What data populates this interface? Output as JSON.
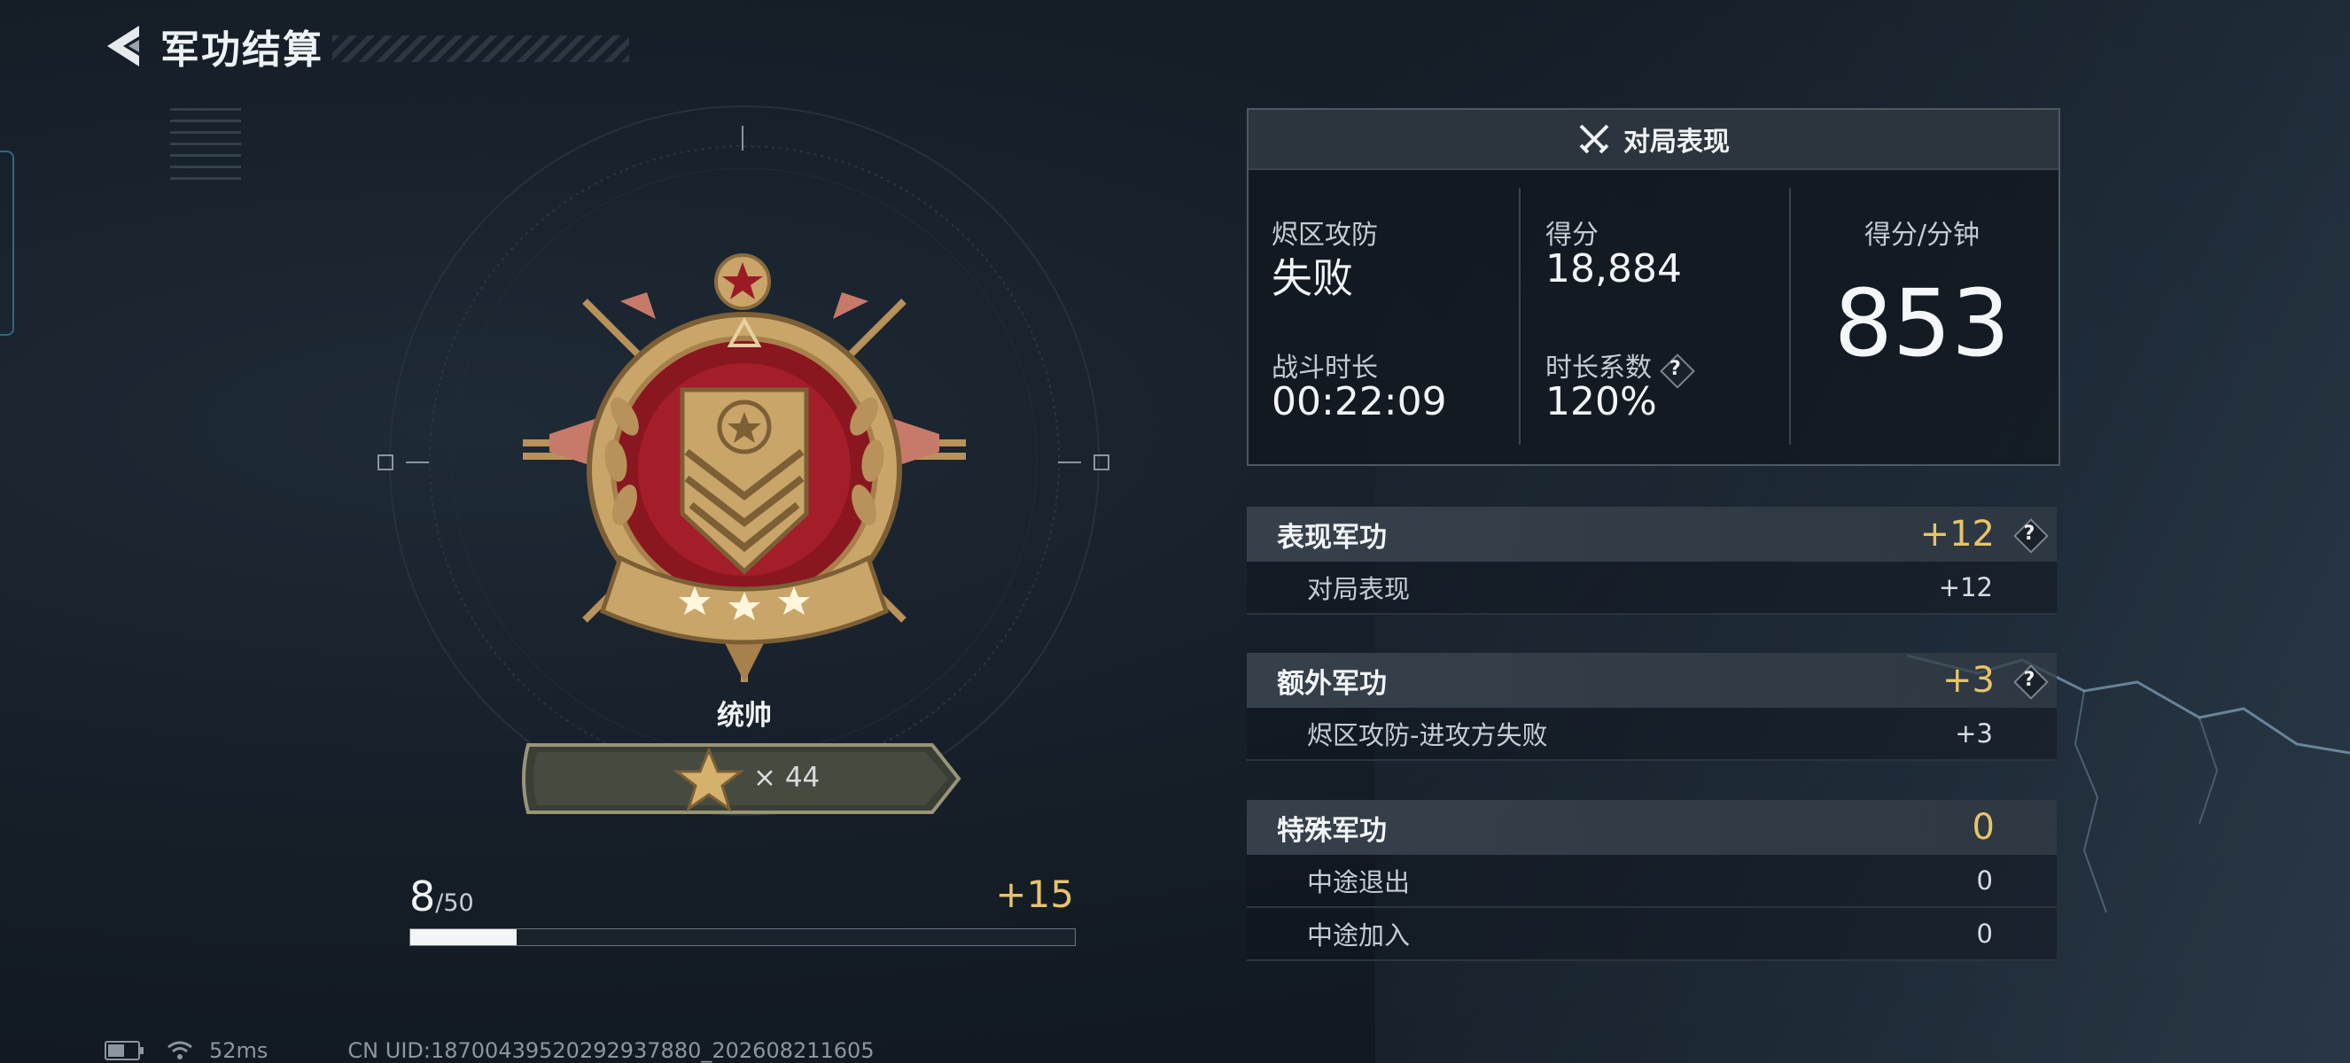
{
  "header": {
    "title": "军功结算"
  },
  "medal": {
    "rank_name": "统帅",
    "stars_text": "× 44"
  },
  "progress": {
    "current": "8",
    "max": "/50",
    "gain": "+15",
    "fraction": 0.16
  },
  "status_bar": {
    "ping": "52ms",
    "uid": "CN UID:18700439520292937880_202608211605"
  },
  "performance": {
    "title": "对局表现",
    "mode_label": "烬区攻防",
    "mode_result": "失败",
    "duration_label": "战斗时长",
    "duration_value": "00:22:09",
    "score_label": "得分",
    "score_value": "18,884",
    "coef_label": "时长系数",
    "coef_value": "120%",
    "spm_label": "得分/分钟",
    "spm_value": "853",
    "help": "?"
  },
  "merit_sections": {
    "performance": {
      "title": "表现军功",
      "total": "+12",
      "rows": [
        {
          "label": "对局表现",
          "value": "+12"
        }
      ]
    },
    "extra": {
      "title": "额外军功",
      "total": "+3",
      "rows": [
        {
          "label": "烬区攻防-进攻方失败",
          "value": "+3"
        }
      ]
    },
    "special": {
      "title": "特殊军功",
      "total": "0",
      "rows": [
        {
          "label": "中途退出",
          "value": "0"
        },
        {
          "label": "中途加入",
          "value": "0"
        }
      ]
    }
  },
  "colors": {
    "accent_gold": "#e8c468",
    "medal_red": "#9b1a24",
    "medal_gold": "#c9a56a"
  }
}
